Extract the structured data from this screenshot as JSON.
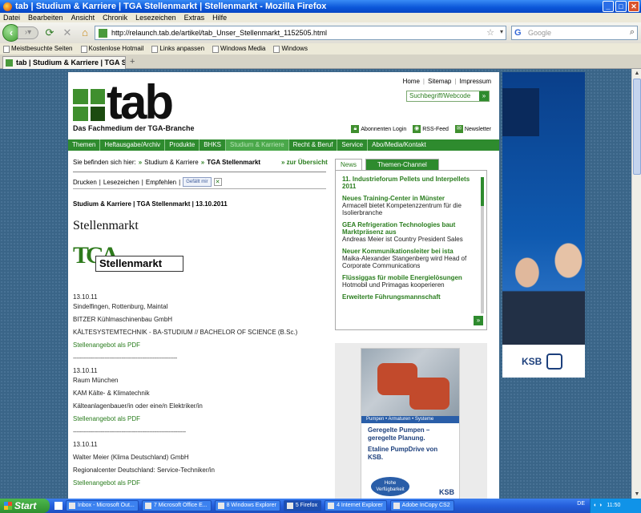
{
  "window": {
    "title": "tab | Studium & Karriere | TGA Stellenmarkt | Stellenmarkt - Mozilla Firefox"
  },
  "menu": [
    "Datei",
    "Bearbeiten",
    "Ansicht",
    "Chronik",
    "Lesezeichen",
    "Extras",
    "Hilfe"
  ],
  "nav": {
    "url": "http://relaunch.tab.de/artikel/tab_Unser_Stellenmarkt_1152505.html",
    "search_placeholder": "Google"
  },
  "bookmarks": [
    "Meistbesuchte Seiten",
    "Kostenlose Hotmail",
    "Links anpassen",
    "Windows Media",
    "Windows"
  ],
  "tab": {
    "label": "tab | Studium & Karriere | TGA Stell..."
  },
  "site": {
    "top_links": [
      "Home",
      "Sitemap",
      "Impressum"
    ],
    "search_label": "Suchbegriff/Webcode",
    "logo_text": "tab",
    "tagline": "Das Fachmedium der TGA-Branche",
    "service_links": [
      "Abonnenten Login",
      "RSS-Feed",
      "Newsletter"
    ],
    "main_nav": [
      "Themen",
      "Heftausgabe/Archiv",
      "Produkte",
      "BHKS",
      "Studium & Karriere",
      "Recht & Beruf",
      "Service",
      "Abo/Media/Kontakt"
    ],
    "breadcrumb": {
      "prefix": "Sie befinden sich hier:",
      "items": [
        "Studium & Karriere",
        "TGA Stellenmarkt"
      ],
      "overview": "zur Übersicht"
    },
    "actions": [
      "Drucken",
      "Lesezeichen",
      "Empfehlen"
    ],
    "fb_like": "Gefällt mir",
    "article": {
      "head": "Studium & Karriere | TGA Stellenmarkt | 13.10.2011",
      "title": "Stellenmarkt",
      "logo_tga": "TGA",
      "logo_badge": "Stellenmarkt"
    },
    "jobs": [
      {
        "date": "13.10.11",
        "location": "Sindelfingen, Rottenburg, Maintal",
        "company": "BITZER Kühlmaschinenbau GmbH",
        "position": "KÄLTESYSTEMTECHNIK - BA-STUDIUM // BACHELOR OF SCIENCE (B.Sc.)",
        "link": "Stellenangebot als PDF",
        "dashes": "------------------------------------------------------------"
      },
      {
        "date": "13.10.11",
        "location": "Raum München",
        "company": "KAM Kälte- & Klimatechnik",
        "position": "Kälteanlagenbauer/in oder eine/n Elektriker/in",
        "link": "Stellenangebot als PDF",
        "dashes": "-----------------------------------------------------------------"
      },
      {
        "date": "13.10.11",
        "location": "",
        "company": "Walter Meier (Klima Deutschland) GmbH",
        "position": "Regionalcenter Deutschland: Service-Techniker/in",
        "link": "Stellenangebot als PDF",
        "dashes": ""
      }
    ],
    "news_tabs": [
      "News",
      "Themen-Channel"
    ],
    "news": [
      {
        "headline": "11. Industrieforum Pellets und Interpellets 2011",
        "text": ""
      },
      {
        "headline": "Neues Training-Center in Münster",
        "text": "Armacell bietet Kompetenzzentrum für die Isolierbranche"
      },
      {
        "headline": "GEA Refrigeration Technologies baut Marktpräsenz aus",
        "text": "Andreas Meier ist Country President Sales"
      },
      {
        "headline": "Neuer Kommunikationsleiter bei ista",
        "text": "Maika-Alexander Stangenberg wird Head of Corporate Communications"
      },
      {
        "headline": "Flüssiggas für mobile Energielösungen",
        "text": "Hotmobil und Primagas kooperieren"
      },
      {
        "headline": "Erweiterte Führungsmannschaft",
        "text": ""
      }
    ],
    "ad_pump": {
      "strip": "Pumpen • Armaturen • Systeme",
      "h1": "Geregelte Pumpen – geregelte Planung.",
      "h2": "Etaline PumpDrive von KSB.",
      "pill": "Hohe Verfügbarkeit",
      "brand": "KSB"
    },
    "ad_right": {
      "brand": "KSB"
    }
  },
  "taskbar": {
    "start": "Start",
    "buttons": [
      "Inbox - Microsoft Out...",
      "7 Microsoft Office E...",
      "8 Windows Explorer",
      "5 Firefox",
      "4 Internet Explorer",
      "Adobe InCopy CS2"
    ],
    "lang": "DE",
    "clock": "11:50"
  }
}
